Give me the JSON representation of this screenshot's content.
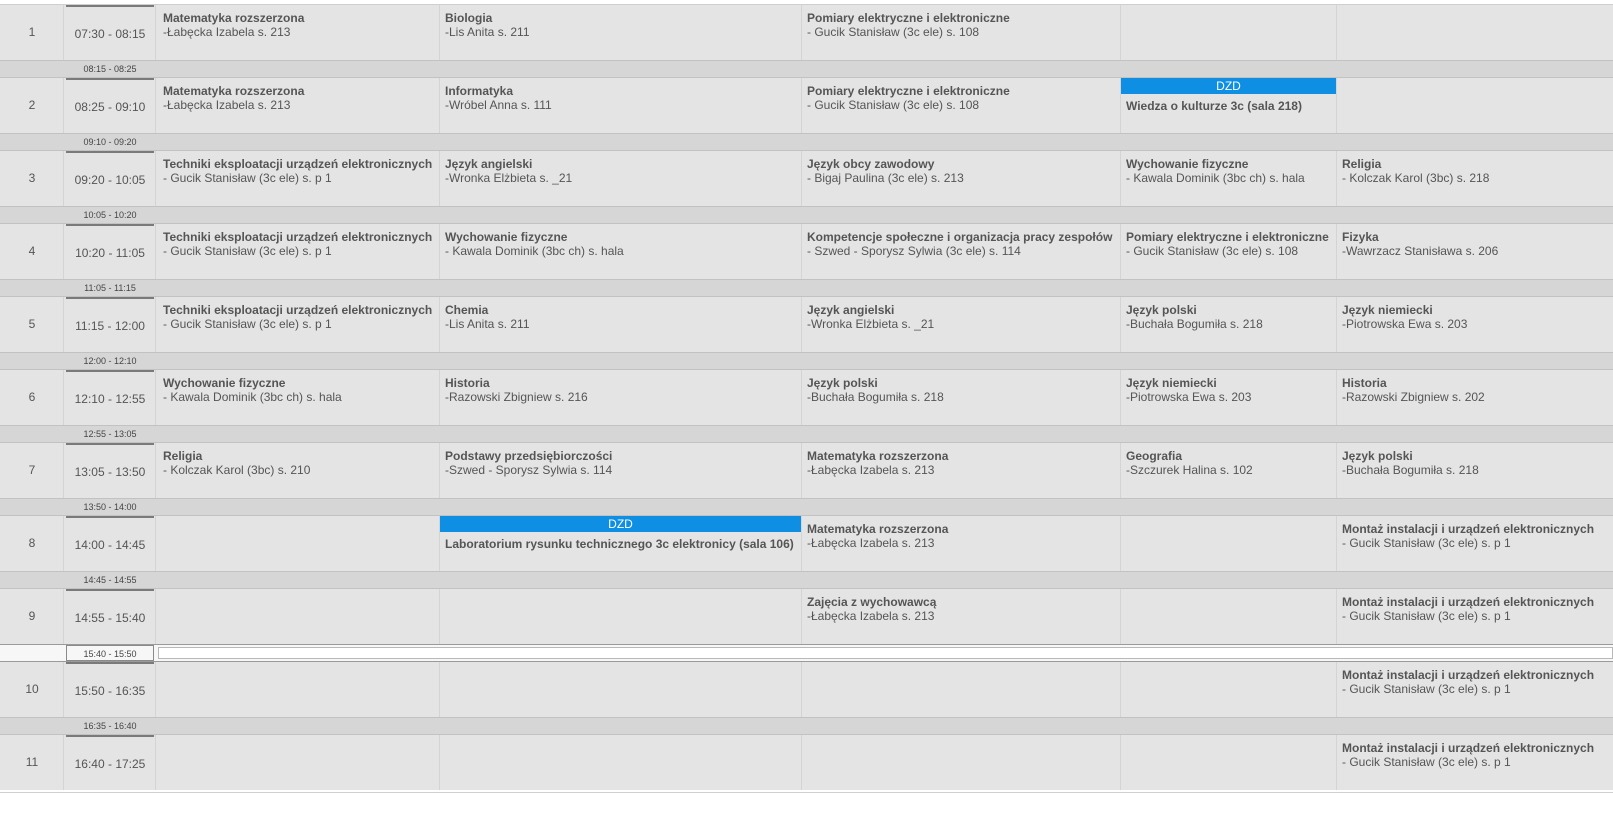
{
  "periods": [
    {
      "num": "1",
      "time": "07:30 - 08:15",
      "break_after": "08:15 - 08:25",
      "cells": [
        {
          "subject": "Matematyka rozszerzona",
          "teacher": "-Łabęcka Izabela  s. 213"
        },
        {
          "subject": "Biologia",
          "teacher": "-Lis Anita  s. 211"
        },
        {
          "subject": "Pomiary elektryczne i elektroniczne",
          "teacher": "- Gucik Stanisław (3c ele)  s. 108"
        },
        null,
        null
      ]
    },
    {
      "num": "2",
      "time": "08:25 - 09:10",
      "break_after": "09:10 - 09:20",
      "cells": [
        {
          "subject": "Matematyka rozszerzona",
          "teacher": "-Łabęcka Izabela  s. 213"
        },
        {
          "subject": "Informatyka",
          "teacher": "-Wróbel Anna  s. 111"
        },
        {
          "subject": "Pomiary elektryczne i elektroniczne",
          "teacher": "- Gucik Stanisław (3c ele)  s. 108"
        },
        {
          "badge": "DZD",
          "title": "Wiedza o kulturze 3c (sala 218)"
        },
        null
      ]
    },
    {
      "num": "3",
      "time": "09:20 - 10:05",
      "break_after": "10:05 - 10:20",
      "cells": [
        {
          "subject": "Techniki eksploatacji urządzeń elektronicznych",
          "teacher": "- Gucik Stanisław (3c ele)  s. p 1"
        },
        {
          "subject": "Język angielski",
          "teacher": "-Wronka Elżbieta  s. _21"
        },
        {
          "subject": "Język obcy zawodowy",
          "teacher": "- Bigaj Paulina (3c ele)  s. 213"
        },
        {
          "subject": "Wychowanie fizyczne",
          "teacher": "- Kawala Dominik (3bc ch)  s. hala"
        },
        {
          "subject": "Religia",
          "teacher": "- Kolczak Karol (3bc)  s. 218"
        }
      ]
    },
    {
      "num": "4",
      "time": "10:20 - 11:05",
      "break_after": "11:05 - 11:15",
      "cells": [
        {
          "subject": "Techniki eksploatacji urządzeń elektronicznych",
          "teacher": "- Gucik Stanisław (3c ele)  s. p 1"
        },
        {
          "subject": "Wychowanie fizyczne",
          "teacher": "- Kawala Dominik (3bc ch)  s. hala"
        },
        {
          "subject": "Kompetencje społeczne i organizacja pracy zespołów",
          "teacher": "- Szwed - Sporysz Sylwia (3c ele)  s. 114"
        },
        {
          "subject": "Pomiary elektryczne i elektroniczne",
          "teacher": "- Gucik Stanisław (3c ele)  s. 108"
        },
        {
          "subject": "Fizyka",
          "teacher": "-Wawrzacz Stanisława  s. 206"
        }
      ]
    },
    {
      "num": "5",
      "time": "11:15 - 12:00",
      "break_after": "12:00 - 12:10",
      "cells": [
        {
          "subject": "Techniki eksploatacji urządzeń elektronicznych",
          "teacher": "- Gucik Stanisław (3c ele)  s. p 1"
        },
        {
          "subject": "Chemia",
          "teacher": "-Lis Anita  s. 211"
        },
        {
          "subject": "Język angielski",
          "teacher": "-Wronka Elżbieta  s. _21"
        },
        {
          "subject": "Język polski",
          "teacher": "-Buchała Bogumiła  s. 218"
        },
        {
          "subject": "Język niemiecki",
          "teacher": "-Piotrowska Ewa  s. 203"
        }
      ]
    },
    {
      "num": "6",
      "time": "12:10 - 12:55",
      "break_after": "12:55 - 13:05",
      "cells": [
        {
          "subject": "Wychowanie fizyczne",
          "teacher": "- Kawala Dominik (3bc ch)  s. hala"
        },
        {
          "subject": "Historia",
          "teacher": "-Razowski Zbigniew  s. 216"
        },
        {
          "subject": "Język polski",
          "teacher": "-Buchała Bogumiła  s. 218"
        },
        {
          "subject": "Język niemiecki",
          "teacher": "-Piotrowska Ewa  s. 203"
        },
        {
          "subject": "Historia",
          "teacher": "-Razowski Zbigniew  s. 202"
        }
      ]
    },
    {
      "num": "7",
      "time": "13:05 - 13:50",
      "break_after": "13:50 - 14:00",
      "cells": [
        {
          "subject": "Religia",
          "teacher": "- Kolczak Karol (3bc)  s. 210"
        },
        {
          "subject": "Podstawy przedsiębiorczości",
          "teacher": "-Szwed - Sporysz Sylwia  s. 114"
        },
        {
          "subject": "Matematyka rozszerzona",
          "teacher": "-Łabęcka Izabela  s. 213"
        },
        {
          "subject": "Geografia",
          "teacher": "-Szczurek Halina  s. 102"
        },
        {
          "subject": "Język polski",
          "teacher": "-Buchała Bogumiła  s. 218"
        }
      ]
    },
    {
      "num": "8",
      "time": "14:00 - 14:45",
      "break_after": "14:45 - 14:55",
      "cells": [
        null,
        {
          "badge": "DZD",
          "title": "Laboratorium rysunku technicznego 3c elektronicy (sala 106)"
        },
        {
          "subject": "Matematyka rozszerzona",
          "teacher": "-Łabęcka Izabela  s. 213"
        },
        null,
        {
          "subject": "Montaż instalacji i urządzeń elektronicznych",
          "teacher": "- Gucik Stanisław (3c ele)  s. p 1"
        }
      ]
    },
    {
      "num": "9",
      "time": "14:55 - 15:40",
      "break_after": "15:40 - 15:50",
      "cells": [
        null,
        null,
        {
          "subject": "Zajęcia z wychowawcą",
          "teacher": "-Łabęcka Izabela  s. 213"
        },
        null,
        {
          "subject": "Montaż instalacji i urządzeń elektronicznych",
          "teacher": "- Gucik Stanisław (3c ele)  s. p 1"
        }
      ]
    },
    {
      "num": "10",
      "time": "15:50 - 16:35",
      "break_after": "16:35 - 16:40",
      "cells": [
        null,
        null,
        null,
        null,
        {
          "subject": "Montaż instalacji i urządzeń elektronicznych",
          "teacher": "- Gucik Stanisław (3c ele)  s. p 1"
        }
      ]
    },
    {
      "num": "11",
      "time": "16:40 - 17:25",
      "break_after": null,
      "cells": [
        null,
        null,
        null,
        null,
        {
          "subject": "Montaż instalacji i urządzeń elektronicznych",
          "teacher": "- Gucik Stanisław (3c ele)  s. p 1"
        }
      ]
    }
  ],
  "colors": {
    "row": "#e4e4e4",
    "break": "#d6d6d6",
    "badge": "#0e8fe3"
  }
}
